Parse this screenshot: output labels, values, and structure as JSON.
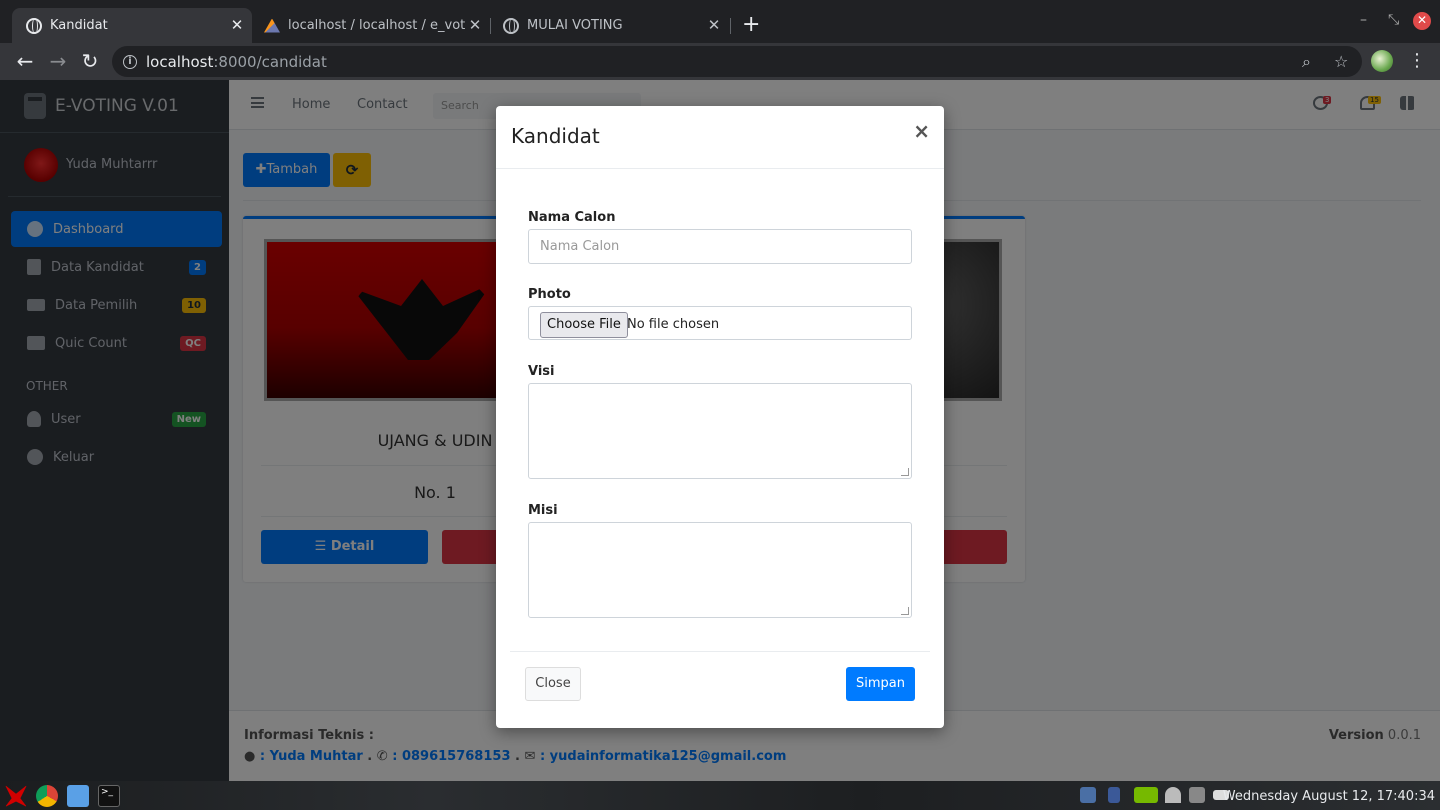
{
  "browser": {
    "tabs": [
      {
        "title": "Kandidat",
        "active": true
      },
      {
        "title": "localhost / localhost / e_vote / u",
        "active": false
      },
      {
        "title": "MULAI VOTING",
        "active": false
      }
    ],
    "url_host": "localhost",
    "url_path": ":8000/candidat"
  },
  "sidebar": {
    "brand": "E-VOTING V.01",
    "user_name": "Yuda Muhtarrr",
    "items": [
      {
        "label": "Dashboard",
        "icon": "dashboard-icon"
      },
      {
        "label": "Data Kandidat",
        "badge": "2",
        "icon": "id-card-icon"
      },
      {
        "label": "Data Pemilih",
        "badge": "10",
        "icon": "users-icon"
      },
      {
        "label": "Quic Count",
        "badge": "QC",
        "icon": "laptop-icon"
      }
    ],
    "other_header": "OTHER",
    "other_items": [
      {
        "label": "User",
        "badge": "New",
        "icon": "user-icon"
      },
      {
        "label": "Keluar",
        "icon": "arrow-right-icon"
      }
    ]
  },
  "topnav": {
    "home": "Home",
    "contact": "Contact",
    "search_placeholder": "Search",
    "messages_count": "3",
    "notifications_count": "15"
  },
  "content": {
    "add_label": "Tambah",
    "refresh_icon": "refresh-icon",
    "candidate": {
      "name": "UJANG & UDIN",
      "number": "No. 1",
      "detail_label": "Detail"
    }
  },
  "footer": {
    "title": "Informasi Teknis :",
    "name": ": Yuda Muhtar",
    "phone": ": 089615768153",
    "email": ": yudainformatika125@gmail.com",
    "version_label": "Version",
    "version": "0.0.1"
  },
  "modal": {
    "title": "Kandidat",
    "close_x": "×",
    "nama_label": "Nama Calon",
    "nama_placeholder": "Nama Calon",
    "photo_label": "Photo",
    "choose_file": "Choose File",
    "no_file": "No file chosen",
    "visi_label": "Visi",
    "misi_label": "Misi",
    "close_button": "Close",
    "save_button": "Simpan"
  },
  "taskbar": {
    "clock": "Wednesday August 12, 17:40:34"
  }
}
